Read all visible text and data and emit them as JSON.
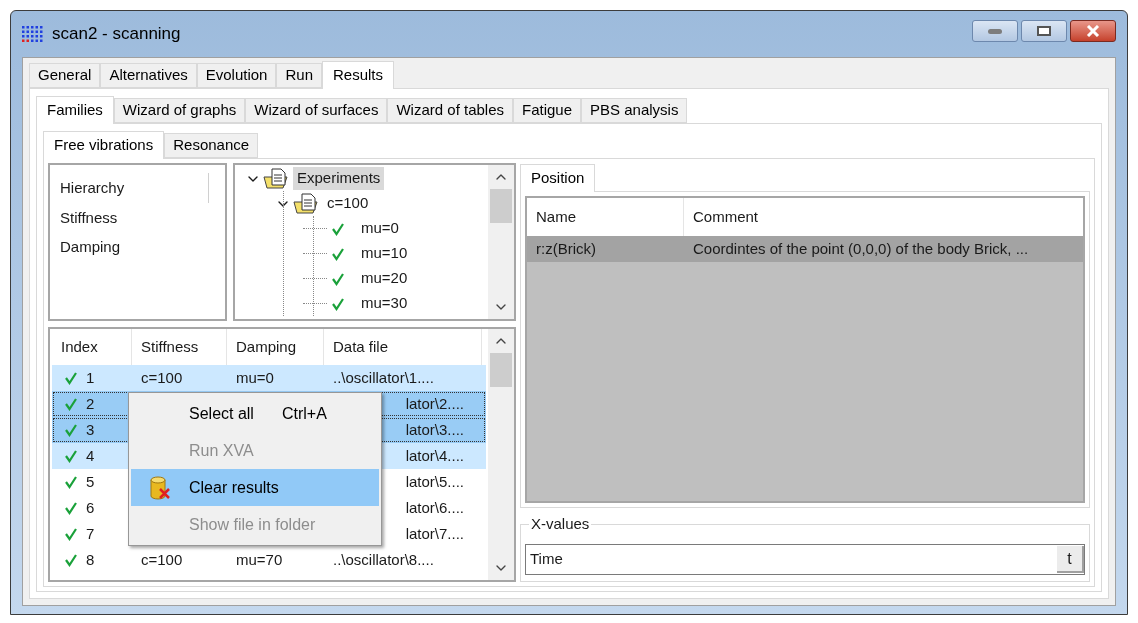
{
  "window": {
    "title": "scan2 - scanning"
  },
  "main_tabs": [
    {
      "label": "General",
      "selected": false
    },
    {
      "label": "Alternatives",
      "selected": false
    },
    {
      "label": "Evolution",
      "selected": false
    },
    {
      "label": "Run",
      "selected": false
    },
    {
      "label": "Results",
      "selected": true
    }
  ],
  "sub_tabs": [
    {
      "label": "Families",
      "selected": true
    },
    {
      "label": "Wizard of graphs",
      "selected": false
    },
    {
      "label": "Wizard of surfaces",
      "selected": false
    },
    {
      "label": "Wizard of tables",
      "selected": false
    },
    {
      "label": "Fatigue",
      "selected": false
    },
    {
      "label": "PBS analysis",
      "selected": false
    }
  ],
  "family_tabs": [
    {
      "label": "Free vibrations",
      "selected": true
    },
    {
      "label": "Resonance",
      "selected": false
    }
  ],
  "hierarchy": {
    "title": "Hierarchy",
    "items": [
      "Stiffness",
      "Damping"
    ]
  },
  "tree": [
    {
      "label": "Experiments",
      "kind": "folder",
      "selected": true,
      "expanded": true,
      "children": [
        {
          "label": "c=100",
          "kind": "folder",
          "selected": false,
          "expanded": true,
          "children": [
            {
              "label": "mu=0",
              "kind": "done",
              "selected": false
            },
            {
              "label": "mu=10",
              "kind": "done",
              "selected": false
            },
            {
              "label": "mu=20",
              "kind": "done",
              "selected": false
            },
            {
              "label": "mu=30",
              "kind": "done",
              "selected": false
            }
          ]
        }
      ]
    }
  ],
  "runs_table": {
    "columns": [
      "Index",
      "Stiffness",
      "Damping",
      "Data file"
    ],
    "rows": [
      {
        "index": "1",
        "stiffness": "c=100",
        "damping": "mu=0",
        "data_file": "..\\oscillator\\1....",
        "done": true,
        "selected": true,
        "focused": false,
        "covered": false
      },
      {
        "index": "2",
        "data_file": "lator\\2....",
        "done": true,
        "selected": true,
        "focused": true,
        "covered": true
      },
      {
        "index": "3",
        "data_file": "lator\\3....",
        "done": true,
        "selected": true,
        "focused": true,
        "covered": true
      },
      {
        "index": "4",
        "data_file": "lator\\4....",
        "done": true,
        "selected": true,
        "focused": false,
        "covered": true
      },
      {
        "index": "5",
        "data_file": "lator\\5....",
        "done": true,
        "selected": false,
        "focused": false,
        "covered": true
      },
      {
        "index": "6",
        "data_file": "lator\\6....",
        "done": true,
        "selected": false,
        "focused": false,
        "covered": true
      },
      {
        "index": "7",
        "data_file": "lator\\7....",
        "done": true,
        "selected": false,
        "focused": false,
        "covered": true
      },
      {
        "index": "8",
        "stiffness": "c=100",
        "damping": "mu=70",
        "data_file": "..\\oscillator\\8....",
        "done": true,
        "selected": false,
        "focused": false,
        "covered": false
      }
    ]
  },
  "context_menu": {
    "items": [
      {
        "label": "Select all",
        "shortcut": "Ctrl+A",
        "disabled": false,
        "highlighted": false,
        "icon": false
      },
      {
        "label": "Run XVA",
        "disabled": true,
        "highlighted": false,
        "icon": false
      },
      {
        "label": "Clear results",
        "disabled": false,
        "highlighted": true,
        "icon": true
      },
      {
        "label": "Show file in folder",
        "disabled": true,
        "highlighted": false,
        "icon": false
      }
    ]
  },
  "right_tabs": [
    {
      "label": "Position",
      "selected": true
    }
  ],
  "variables_table": {
    "columns": [
      "Name",
      "Comment"
    ],
    "rows": [
      {
        "name": "r:z(Brick)",
        "comment": "Coordintes of the point (0,0,0) of the body Brick, ...",
        "selected": true
      }
    ]
  },
  "x_values": {
    "title": "X-values",
    "value": "Time",
    "button": "t"
  }
}
